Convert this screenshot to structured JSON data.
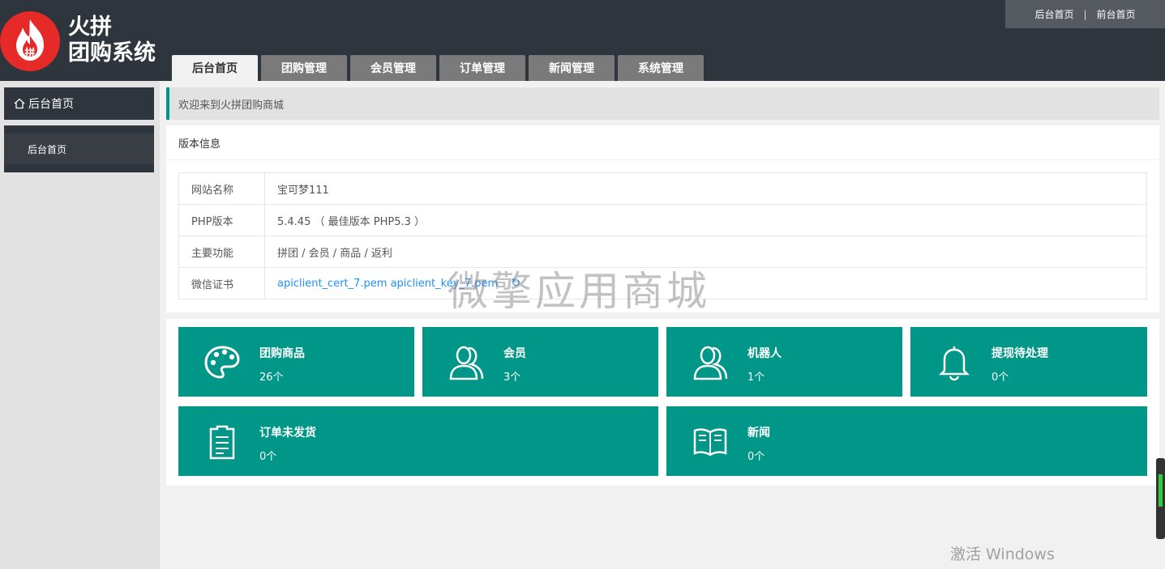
{
  "logo": {
    "badge": "拼",
    "line1": "火拼",
    "line2": "团购系统"
  },
  "top_links": {
    "admin_home": "后台首页",
    "separator": "|",
    "front_home": "前台首页"
  },
  "tabs": [
    {
      "label": "后台首页",
      "active": true
    },
    {
      "label": "团购管理"
    },
    {
      "label": "会员管理"
    },
    {
      "label": "订单管理"
    },
    {
      "label": "新闻管理"
    },
    {
      "label": "系统管理"
    }
  ],
  "sidebar": {
    "header": "后台首页",
    "items": [
      {
        "label": "后台首页"
      }
    ]
  },
  "welcome": "欢迎来到火拼团购商城",
  "panel": {
    "title": "版本信息",
    "rows": [
      {
        "key": "网站名称",
        "value": "宝可梦111"
      },
      {
        "key": "PHP版本",
        "value": "5.4.45 （ 最佳版本 PHP5.3 ）"
      },
      {
        "key": "主要功能",
        "value": "拼团 / 会员 / 商品 / 返利"
      },
      {
        "key": "微信证书",
        "link1": "apiclient_cert_7.pem",
        "link2": "apiclient_key_7.pem"
      }
    ]
  },
  "cards": [
    {
      "title": "团购商品",
      "value": "26个",
      "icon": "palette-icon"
    },
    {
      "title": "会员",
      "value": "3个",
      "icon": "users-icon"
    },
    {
      "title": "机器人",
      "value": "1个",
      "icon": "users-icon"
    },
    {
      "title": "提现待处理",
      "value": "0个",
      "icon": "bell-icon"
    },
    {
      "title": "订单未发货",
      "value": "0个",
      "icon": "clipboard-icon"
    },
    {
      "title": "新闻",
      "value": "0个",
      "icon": "book-icon"
    }
  ],
  "watermark": "微擎应用商城",
  "windows_activation": "激活 Windows",
  "colors": {
    "accent": "#009688",
    "header": "#2f353d",
    "logo_red": "#e52a28"
  }
}
